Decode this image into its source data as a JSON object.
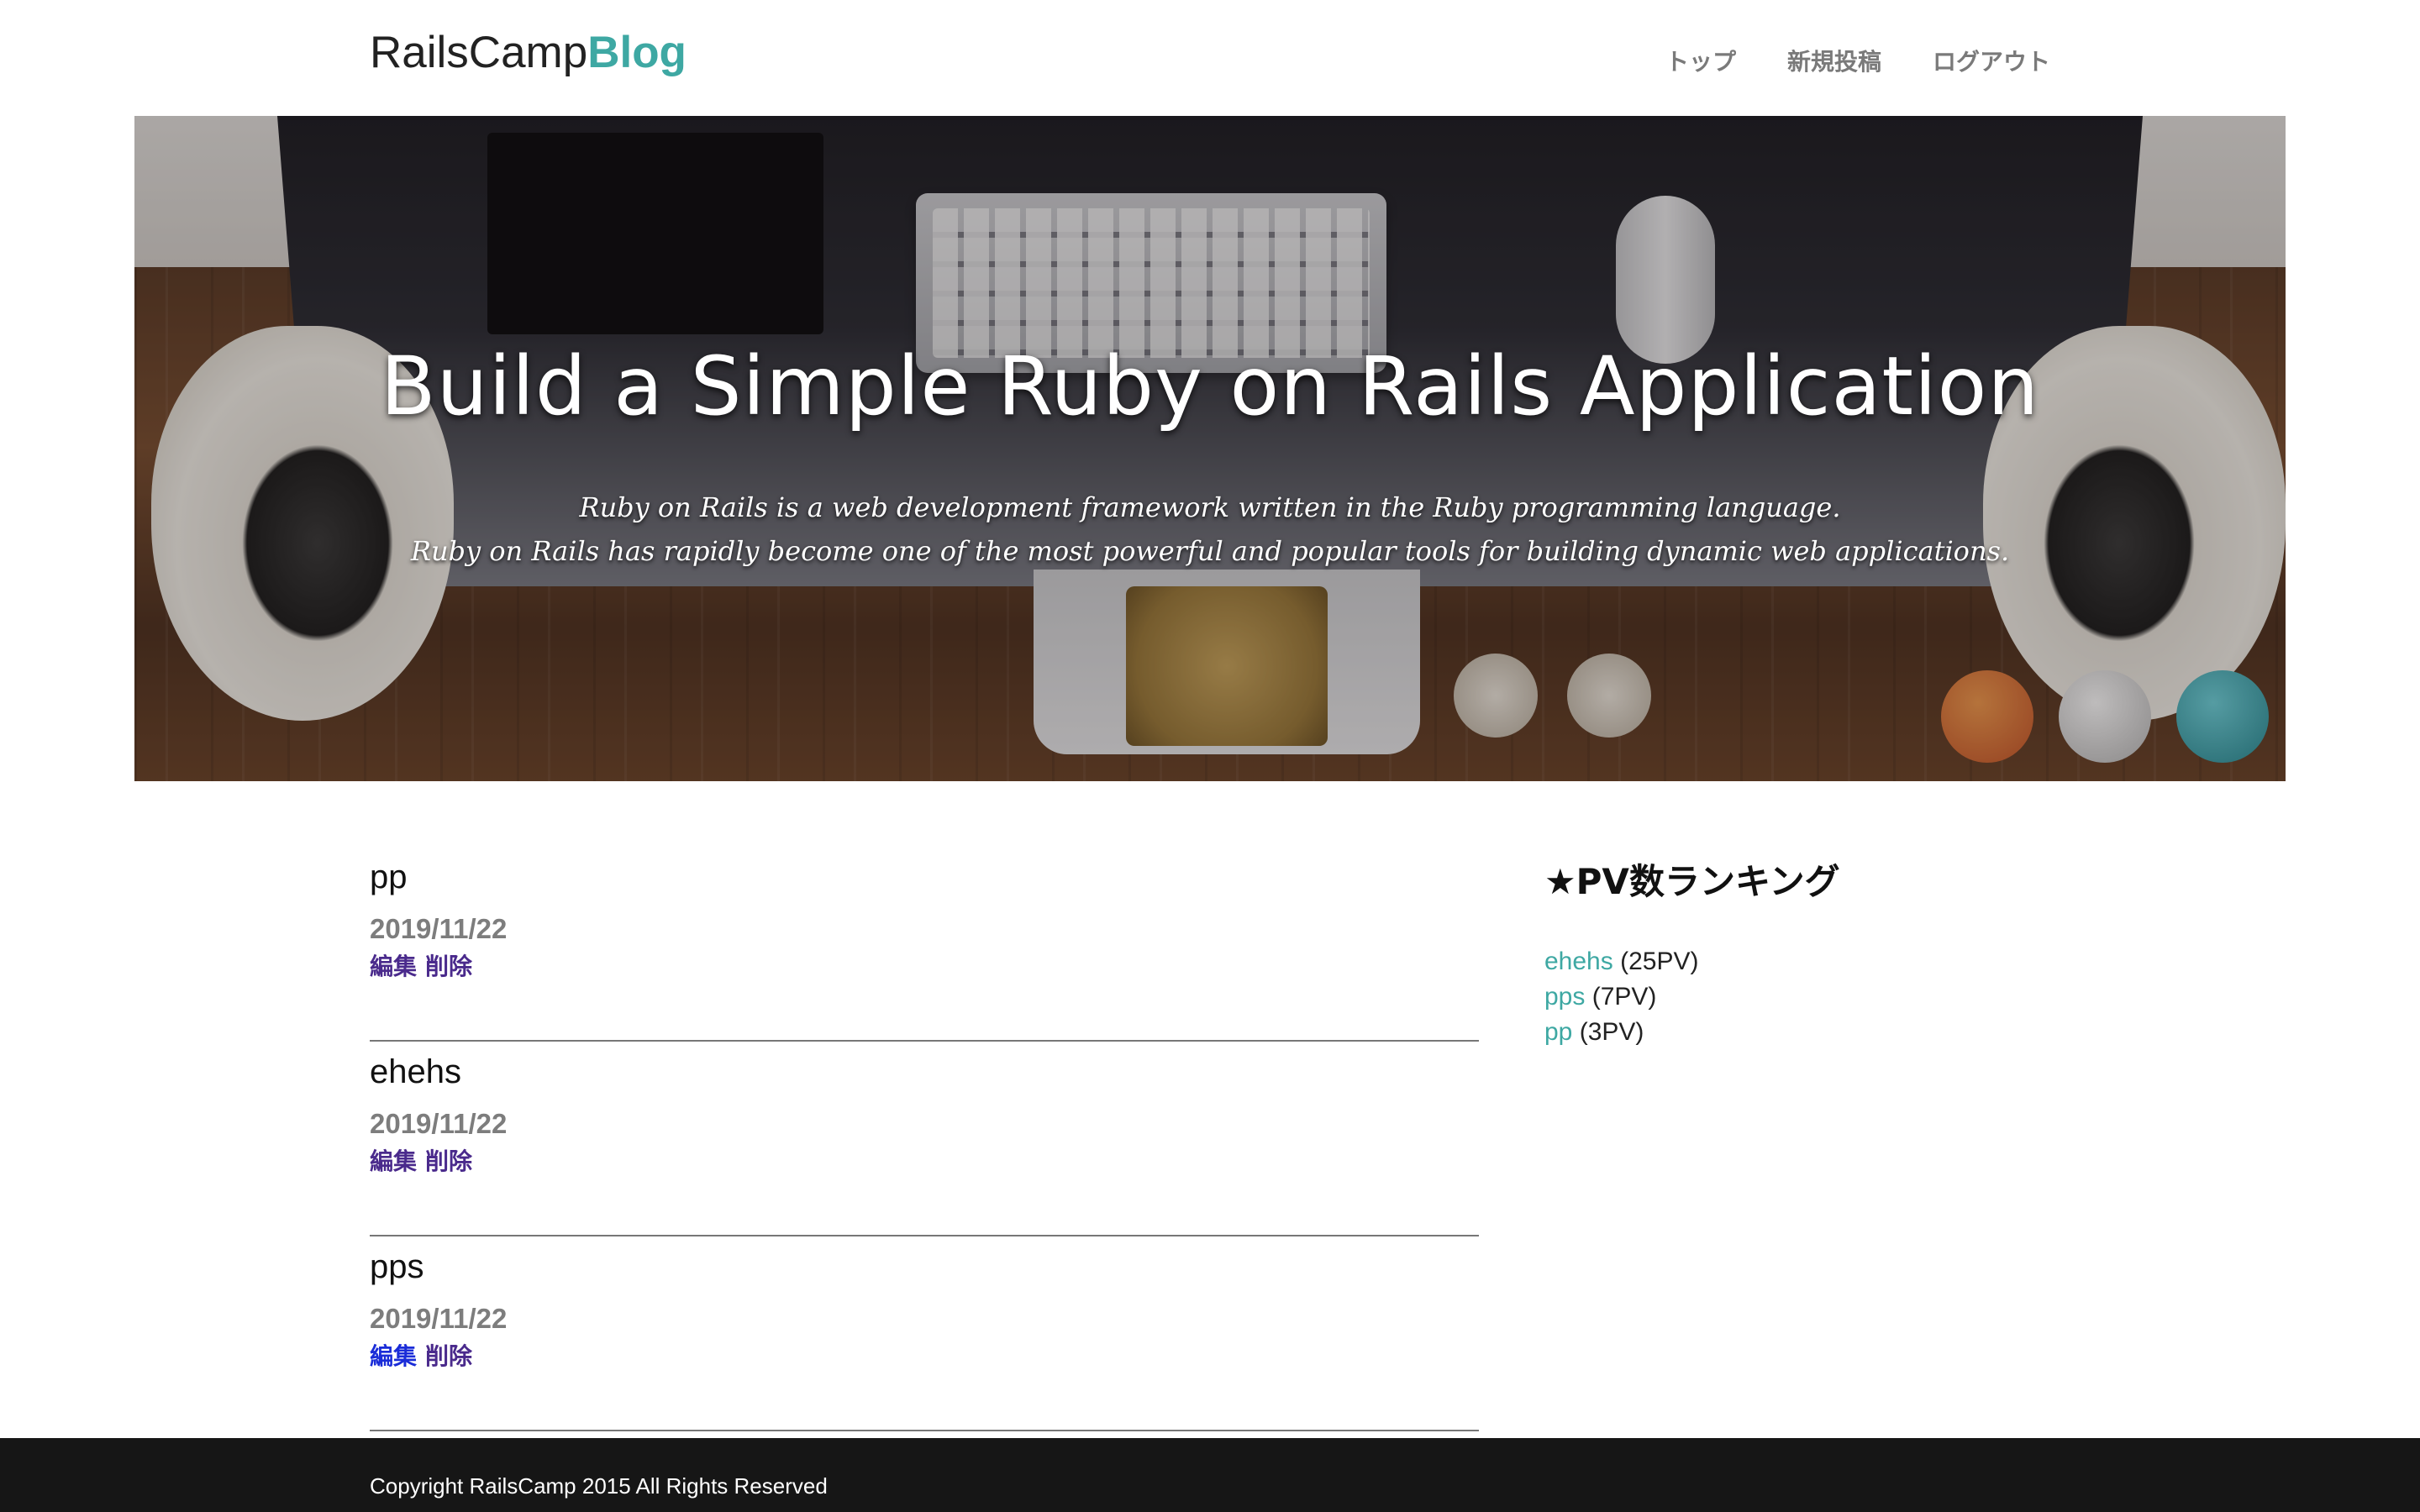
{
  "header": {
    "logo_main": "RailsCamp",
    "logo_accent": "Blog",
    "nav": [
      {
        "label": "トップ"
      },
      {
        "label": "新規投稿"
      },
      {
        "label": "ログアウト"
      }
    ]
  },
  "hero": {
    "title": "Build a Simple Ruby on Rails Application",
    "subtitle_line1": "Ruby on Rails is a web development framework written in the Ruby programming language.",
    "subtitle_line2": "Ruby on Rails has rapidly become one of the most powerful and popular tools for building dynamic web applications."
  },
  "posts": [
    {
      "title": "pp",
      "date": "2019/11/22",
      "edit_label": "編集",
      "delete_label": "削除"
    },
    {
      "title": "ehehs",
      "date": "2019/11/22",
      "edit_label": "編集",
      "delete_label": "削除"
    },
    {
      "title": "pps",
      "date": "2019/11/22",
      "edit_label": "編集",
      "delete_label": "削除"
    }
  ],
  "sidebar": {
    "title": "★PV数ランキング",
    "ranking": [
      {
        "name": "ehehs",
        "count": "(25PV)"
      },
      {
        "name": "pps",
        "count": "(7PV)"
      },
      {
        "name": "pp",
        "count": "(3PV)"
      }
    ]
  },
  "footer": {
    "copyright": "Copyright RailsCamp 2015 All Rights Reserved"
  },
  "colors": {
    "accent": "#3ea8a3",
    "link_visited": "#4a2a8c",
    "link_active": "#1a2cd8",
    "footer_bg": "#161616"
  }
}
